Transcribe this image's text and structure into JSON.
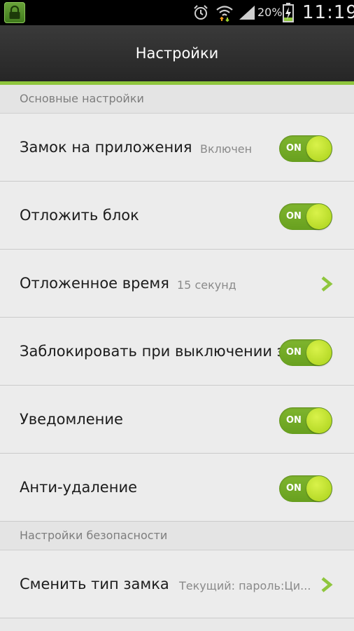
{
  "status_bar": {
    "battery_percent": "20%",
    "time": "11:19",
    "icons": [
      "app-lock-icon",
      "alarm-icon",
      "wifi-icon",
      "signal-icon",
      "battery-charging-icon"
    ]
  },
  "action_bar": {
    "title": "Настройки",
    "accent_color": "#8fc63d"
  },
  "sections": {
    "general": {
      "header": "Основные настройки",
      "rows": {
        "app_lock": {
          "title": "Замок на приложения",
          "summary": "Включен",
          "toggle_label": "ON",
          "toggle_on": true
        },
        "delay_lock": {
          "title": "Отложить блок",
          "toggle_label": "ON",
          "toggle_on": true
        },
        "delay_time": {
          "title": "Отложенное время",
          "summary": "15 секунд"
        },
        "lock_on_screen_off": {
          "title": "Заблокировать при выключении э",
          "toggle_label": "ON",
          "toggle_on": true
        },
        "notification": {
          "title": "Уведомление",
          "toggle_label": "ON",
          "toggle_on": true
        },
        "anti_uninstall": {
          "title": "Анти-удаление",
          "toggle_label": "ON",
          "toggle_on": true
        }
      }
    },
    "security": {
      "header": "Настройки безопасности",
      "rows": {
        "change_lock_type": {
          "title": "Сменить тип замка",
          "summary": "Текущий: пароль:Ци..."
        }
      }
    }
  }
}
